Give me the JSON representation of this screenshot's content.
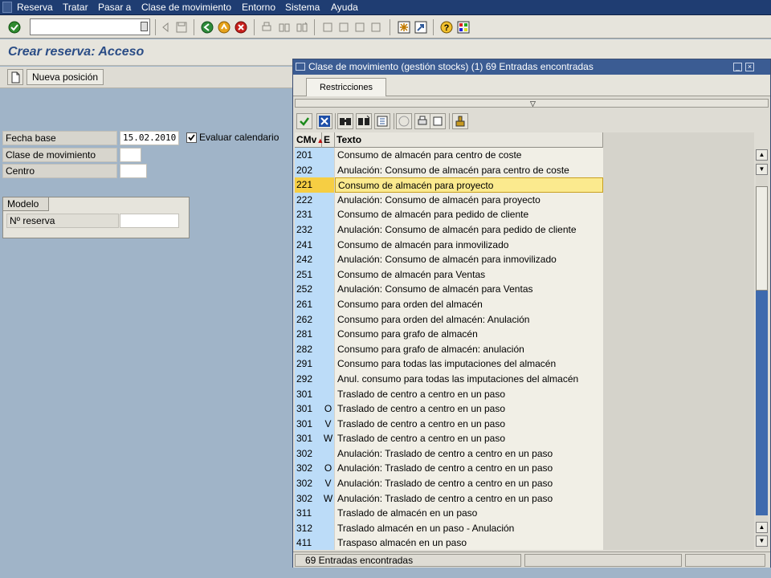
{
  "menu": [
    "Reserva",
    "Tratar",
    "Pasar a",
    "Clase de movimiento",
    "Entorno",
    "Sistema",
    "Ayuda"
  ],
  "page_title": "Crear reserva: Acceso",
  "app_toolbar": {
    "new_position_label": "Nueva posición"
  },
  "form": {
    "fecha_base_label": "Fecha base",
    "fecha_base_value": "15.02.2010",
    "evaluar_calendario_label": "Evaluar calendario",
    "evaluar_calendario_checked": true,
    "clase_movimiento_label": "Clase de movimiento",
    "centro_label": "Centro",
    "modelo_title": "Modelo",
    "reserva_label": "Nº reserva"
  },
  "popup": {
    "title": "Clase de movimiento (gestión stocks) (1)   69 Entradas encontradas",
    "tab": "Restricciones",
    "columns": {
      "cmv": "CMv",
      "e": "E",
      "texto": "Texto"
    },
    "selected_index": 2,
    "rows": [
      {
        "cmv": "201",
        "e": "",
        "texto": "Consumo de almacén para centro de coste"
      },
      {
        "cmv": "202",
        "e": "",
        "texto": "Anulación: Consumo de almacén para centro de coste"
      },
      {
        "cmv": "221",
        "e": "",
        "texto": "Consumo de almacén para proyecto"
      },
      {
        "cmv": "222",
        "e": "",
        "texto": "Anulación: Consumo de almacén para proyecto"
      },
      {
        "cmv": "231",
        "e": "",
        "texto": "Consumo de almacén para pedido de cliente"
      },
      {
        "cmv": "232",
        "e": "",
        "texto": "Anulación: Consumo de almacén para pedido de cliente"
      },
      {
        "cmv": "241",
        "e": "",
        "texto": "Consumo de almacén para inmovilizado"
      },
      {
        "cmv": "242",
        "e": "",
        "texto": "Anulación: Consumo de almacén para inmovilizado"
      },
      {
        "cmv": "251",
        "e": "",
        "texto": "Consumo de almacén para Ventas"
      },
      {
        "cmv": "252",
        "e": "",
        "texto": "Anulación: Consumo de almacén para Ventas"
      },
      {
        "cmv": "261",
        "e": "",
        "texto": "Consumo para orden del almacén"
      },
      {
        "cmv": "262",
        "e": "",
        "texto": "Consumo para orden del almacén: Anulación"
      },
      {
        "cmv": "281",
        "e": "",
        "texto": "Consumo para grafo de almacén"
      },
      {
        "cmv": "282",
        "e": "",
        "texto": "Consumo para grafo de almacén: anulación"
      },
      {
        "cmv": "291",
        "e": "",
        "texto": "Consumo para todas las imputaciones del almacén"
      },
      {
        "cmv": "292",
        "e": "",
        "texto": "Anul. consumo para todas las imputaciones del almacén"
      },
      {
        "cmv": "301",
        "e": "",
        "texto": "Traslado de centro a centro en un paso"
      },
      {
        "cmv": "301",
        "e": "O",
        "texto": "Traslado de centro a centro en un paso"
      },
      {
        "cmv": "301",
        "e": "V",
        "texto": "Traslado de centro a centro en un paso"
      },
      {
        "cmv": "301",
        "e": "W",
        "texto": "Traslado de centro a centro en un paso"
      },
      {
        "cmv": "302",
        "e": "",
        "texto": "Anulación: Traslado de centro a centro en un paso"
      },
      {
        "cmv": "302",
        "e": "O",
        "texto": "Anulación: Traslado de centro a centro en un paso"
      },
      {
        "cmv": "302",
        "e": "V",
        "texto": "Anulación: Traslado de centro a centro en un paso"
      },
      {
        "cmv": "302",
        "e": "W",
        "texto": "Anulación: Traslado de centro a centro en un paso"
      },
      {
        "cmv": "311",
        "e": "",
        "texto": "Traslado de almacén en un paso"
      },
      {
        "cmv": "312",
        "e": "",
        "texto": "Traslado almacén en un paso - Anulación"
      },
      {
        "cmv": "411",
        "e": "",
        "texto": "Traspaso almacén en un paso"
      }
    ],
    "status": "69 Entradas encontradas"
  }
}
